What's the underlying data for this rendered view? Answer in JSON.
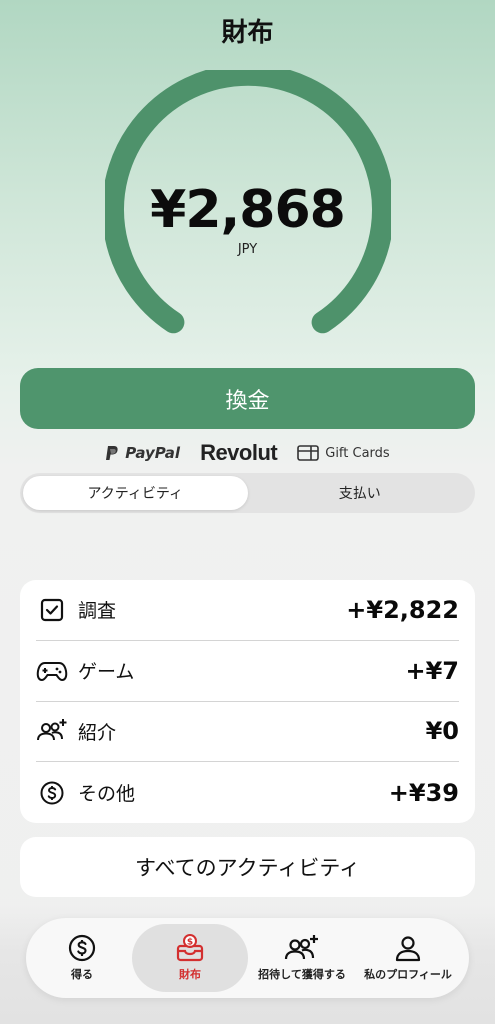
{
  "header": {
    "title": "財布"
  },
  "balance": {
    "amount": "¥2,868",
    "currency": "JPY",
    "gauge_fill_fraction": 0.75
  },
  "withdraw": {
    "label": "換金"
  },
  "providers": {
    "paypal": "PayPal",
    "revolut": "Revolut",
    "giftcards": "Gift Cards"
  },
  "tabs": {
    "activity": "アクティビティ",
    "payments": "支払い",
    "active": "activity"
  },
  "activity": [
    {
      "icon": "checkbox-icon",
      "label": "調査",
      "value": "+¥2,822"
    },
    {
      "icon": "gamepad-icon",
      "label": "ゲーム",
      "value": "+¥7"
    },
    {
      "icon": "referral-icon",
      "label": "紹介",
      "value": "¥0"
    },
    {
      "icon": "dollar-coin-icon",
      "label": "その他",
      "value": "+¥39"
    }
  ],
  "all_activity": {
    "label": "すべてのアクティビティ"
  },
  "nav": {
    "earn": "得る",
    "wallet": "財布",
    "invite": "招待して獲得する",
    "profile": "私のプロフィール",
    "active": "wallet"
  },
  "colors": {
    "accent": "#4f956d",
    "nav_active": "#d32f2f"
  }
}
